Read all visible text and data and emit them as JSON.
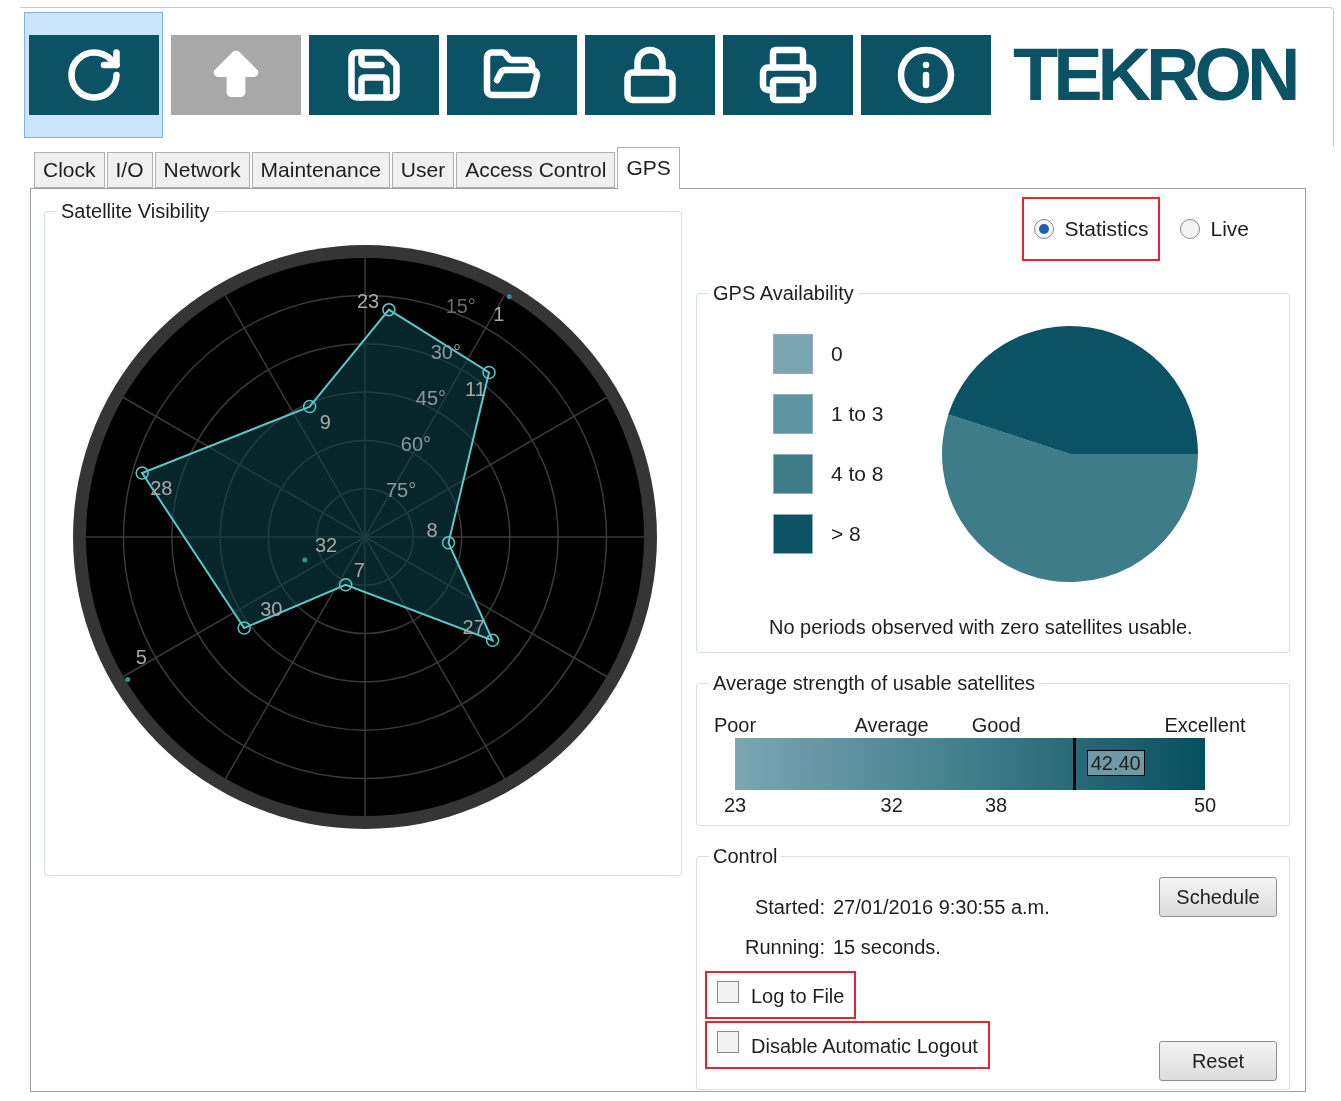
{
  "toolbar": [
    {
      "kind": "refresh",
      "selected": true,
      "disabled": false
    },
    {
      "kind": "upload",
      "selected": false,
      "disabled": true
    },
    {
      "kind": "save",
      "selected": false,
      "disabled": false
    },
    {
      "kind": "folder",
      "selected": false,
      "disabled": false
    },
    {
      "kind": "lock",
      "selected": false,
      "disabled": false
    },
    {
      "kind": "print",
      "selected": false,
      "disabled": false
    },
    {
      "kind": "info",
      "selected": false,
      "disabled": false
    }
  ],
  "logo": "TEKRON",
  "tabs": [
    {
      "label": "Clock",
      "selected": false
    },
    {
      "label": "I/O",
      "selected": false
    },
    {
      "label": "Network",
      "selected": false
    },
    {
      "label": "Maintenance",
      "selected": false
    },
    {
      "label": "User",
      "selected": false
    },
    {
      "label": "Access Control",
      "selected": false
    },
    {
      "label": "GPS",
      "selected": true
    }
  ],
  "satellite_visibility": {
    "title": "Satellite Visibility",
    "elevation_labels": [
      "15°",
      "30°",
      "45°",
      "60°",
      "75°"
    ],
    "satellites": [
      {
        "label": "23",
        "kind": "tracked"
      },
      {
        "label": "11",
        "kind": "tracked"
      },
      {
        "label": "8",
        "kind": "tracked"
      },
      {
        "label": "27",
        "kind": "tracked"
      },
      {
        "label": "7",
        "kind": "tracked"
      },
      {
        "label": "30",
        "kind": "tracked"
      },
      {
        "label": "28",
        "kind": "tracked"
      },
      {
        "label": "9",
        "kind": "tracked"
      },
      {
        "label": "1",
        "kind": "visible"
      },
      {
        "label": "5",
        "kind": "visible"
      },
      {
        "label": "32",
        "kind": "visible"
      }
    ]
  },
  "mode": [
    {
      "label": "Statistics",
      "selected": true,
      "highlighted": true
    },
    {
      "label": "Live",
      "selected": false,
      "highlighted": false
    }
  ],
  "gps_availability": {
    "title": "GPS Availability",
    "chart_data": {
      "type": "pie",
      "categories": [
        "0",
        "1 to 3",
        "4 to 8",
        "> 8"
      ],
      "values": [
        0,
        0,
        55,
        45
      ]
    },
    "note": "No periods observed with zero satellites usable."
  },
  "strength": {
    "title": "Average strength of usable satellites",
    "scale": [
      {
        "label": "Poor",
        "tick": "23"
      },
      {
        "label": "Average",
        "tick": "32"
      },
      {
        "label": "Good",
        "tick": "38"
      },
      {
        "label": "Excellent",
        "tick": "50"
      }
    ],
    "level": 0.7185,
    "reading": "42.40"
  },
  "control": {
    "title": "Control",
    "fields": [
      {
        "label": "Started:",
        "value": "27/01/2016 9:30:55 a.m."
      },
      {
        "label": "Running:",
        "value": "15 seconds."
      }
    ],
    "checkboxes": [
      {
        "label": "Log to File",
        "checked": false,
        "highlighted": true
      },
      {
        "label": "Disable Automatic Logout",
        "checked": false,
        "highlighted": true
      }
    ],
    "buttons": [
      "Schedule",
      "Reset"
    ]
  }
}
